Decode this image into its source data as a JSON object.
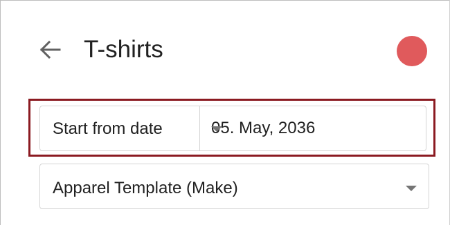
{
  "header": {
    "title": "T-shirts",
    "back_icon": "arrow-left-icon",
    "status_color": "#e05a5c"
  },
  "schedule": {
    "mode_selected": "Start from date",
    "date_value": "05. May, 2036",
    "highlight_color": "#8b1a21"
  },
  "template": {
    "selected": "Apparel Template (Make)"
  }
}
